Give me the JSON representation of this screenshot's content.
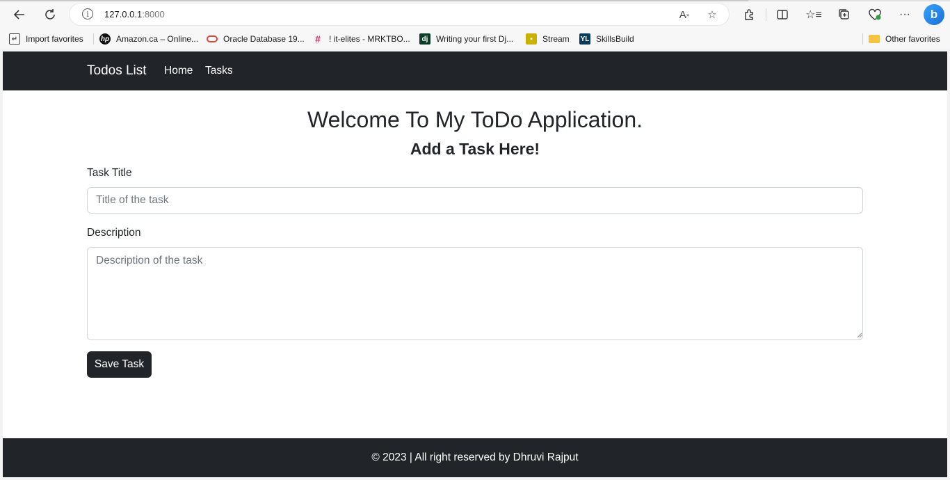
{
  "browser": {
    "address": "127.0.0.1",
    "port": ":8000"
  },
  "favorites": [
    {
      "label": "Import favorites",
      "icon": "import-icon"
    },
    {
      "label": "Amazon.ca – Online...",
      "icon": "hp-icon"
    },
    {
      "label": "Oracle Database 19...",
      "icon": "oracle-icon"
    },
    {
      "label": "! it-elites - MRKTBO...",
      "icon": "slack-icon"
    },
    {
      "label": "Writing your first Dj...",
      "icon": "django-icon"
    },
    {
      "label": "Stream",
      "icon": "stream-icon"
    },
    {
      "label": "SkillsBuild",
      "icon": "skillsbuild-icon"
    },
    {
      "label": "Other favorites",
      "icon": "folder-icon"
    }
  ],
  "navbar": {
    "brand": "Todos List",
    "links": [
      "Home",
      "Tasks"
    ]
  },
  "main": {
    "title": "Welcome To My ToDo Application.",
    "subtitle": "Add a Task Here!",
    "task_title_label": "Task Title",
    "task_title_placeholder": "Title of the task",
    "description_label": "Description",
    "description_placeholder": "Description of the task",
    "save_label": "Save Task"
  },
  "footer": {
    "text": "© 2023 | All right reserved by Dhruvi Rajput"
  },
  "colors": {
    "navbar_bg": "#212529",
    "button_bg": "#212529",
    "page_bg": "#ffffff"
  }
}
